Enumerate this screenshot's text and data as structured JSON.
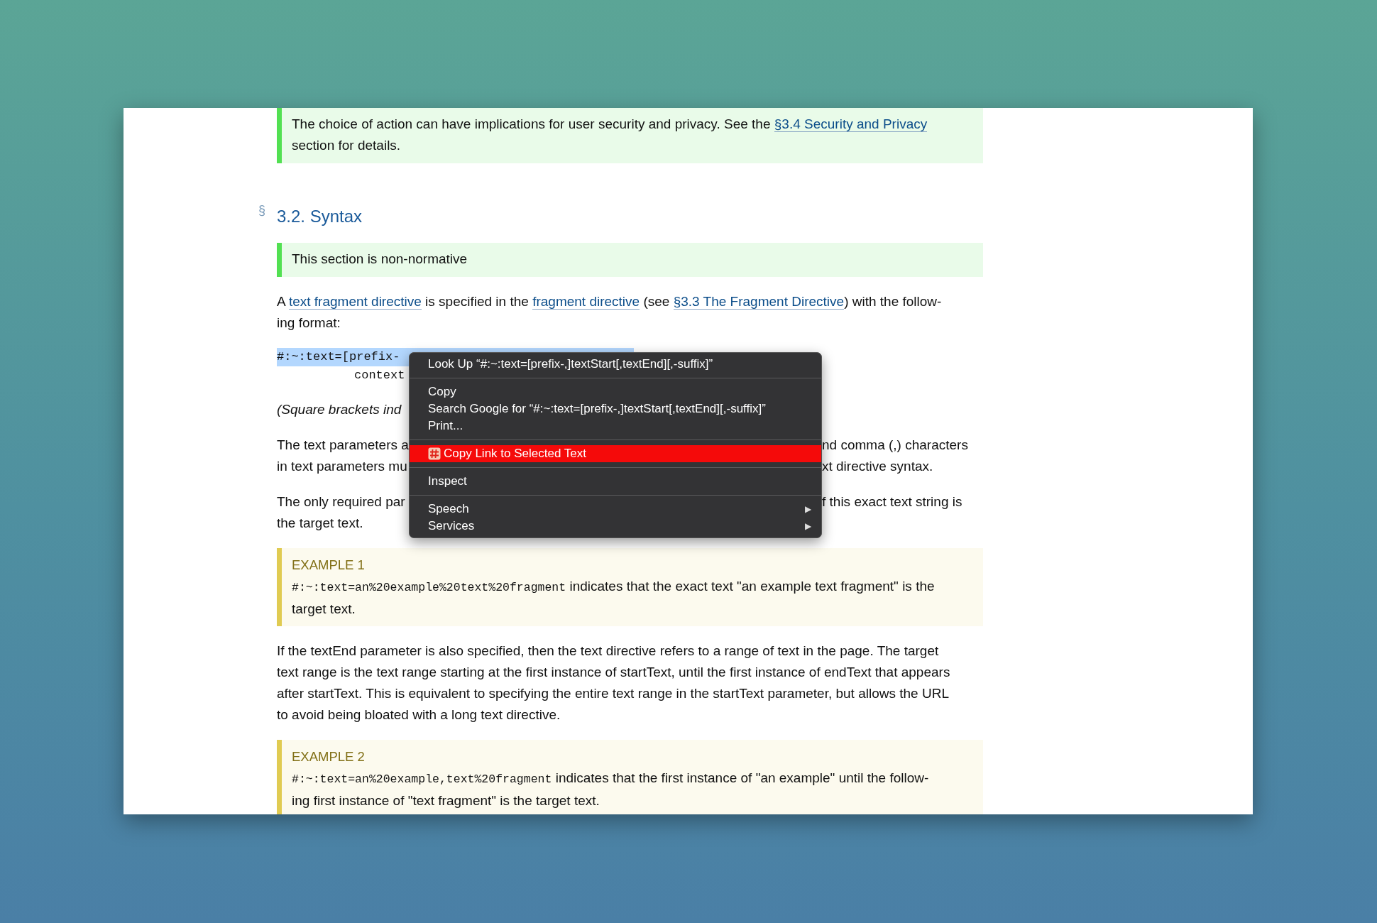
{
  "blocks": [
    {
      "kind": "note",
      "lines": [
        [
          {
            "text": "The choice of action can have implications for user security and privacy. See the "
          },
          {
            "text": "§3.4 Security and Privacy",
            "link": true
          }
        ],
        [
          {
            "text": "section for details."
          }
        ]
      ]
    },
    {
      "kind": "heading",
      "marker": "§",
      "title": "3.2. Syntax"
    },
    {
      "kind": "note",
      "lines": [
        [
          {
            "text": "This section is non-normative"
          }
        ]
      ]
    },
    {
      "kind": "paragraph",
      "lines": [
        [
          {
            "text": "A "
          },
          {
            "text": "text fragment directive",
            "link": true
          },
          {
            "text": " is specified in the "
          },
          {
            "text": "fragment directive",
            "link": true
          },
          {
            "text": " (see "
          },
          {
            "text": "§3.3 The Fragment Directive",
            "link": true
          },
          {
            "text": ") with the follow-"
          }
        ],
        [
          {
            "text": "ing format:"
          }
        ]
      ]
    },
    {
      "kind": "code",
      "lines": [
        {
          "text": "#:~:text=[prefix-",
          "selected": true,
          "indent": false
        },
        {
          "text": "context",
          "selected": false,
          "indent": true
        }
      ]
    },
    {
      "kind": "covered",
      "italic": true,
      "lines": [
        {
          "left": "(Square brackets ind"
        }
      ]
    },
    {
      "kind": "covered",
      "italic": false,
      "lines": [
        {
          "left": "The text parameters a",
          "right": "nd comma (,) characters"
        },
        {
          "left": "in text parameters mu",
          "right": "xt directive syntax."
        }
      ]
    },
    {
      "kind": "covered",
      "italic": false,
      "lines": [
        {
          "left": "The only required par",
          "right": "f this exact text string is"
        },
        {
          "left": "the target text."
        }
      ]
    },
    {
      "kind": "example",
      "label": "EXAMPLE 1",
      "lines": [
        [
          {
            "text": "#:~:text=an%20example%20text%20fragment",
            "code": true
          },
          {
            "text": " indicates that the exact text \"an example text fragment\" is the"
          }
        ],
        [
          {
            "text": "target text."
          }
        ]
      ]
    },
    {
      "kind": "paragraph",
      "lines": [
        [
          {
            "text": "If the textEnd parameter is also specified, then the text directive refers to a range of text in the page. The target"
          }
        ],
        [
          {
            "text": "text range is the text range starting at the first instance of startText, until the first instance of endText that appears"
          }
        ],
        [
          {
            "text": "after startText. This is equivalent to specifying the entire text range in the startText parameter, but allows the URL"
          }
        ],
        [
          {
            "text": "to avoid being bloated with a long text directive."
          }
        ]
      ]
    },
    {
      "kind": "example",
      "label": "EXAMPLE 2",
      "lines": [
        [
          {
            "text": "#:~:text=an%20example,text%20fragment",
            "code": true
          },
          {
            "text": " indicates that the first instance of \"an example\" until the follow-"
          }
        ],
        [
          {
            "text": "ing first instance of \"text fragment\" is the target text."
          }
        ]
      ]
    }
  ],
  "context_menu": {
    "groups": [
      {
        "items": [
          {
            "label": "Look Up “#:~:text=[prefix-,]textStart[,textEnd][,-suffix]”",
            "selected": false
          }
        ]
      },
      {
        "items": [
          {
            "label": "Copy",
            "selected": false
          },
          {
            "label": "Search Google for “#:~:text=[prefix-,]textStart[,textEnd][,-suffix]”",
            "selected": false
          },
          {
            "label": "Print...",
            "selected": false
          }
        ]
      },
      {
        "items": [
          {
            "label": "Copy Link to Selected Text",
            "selected": true,
            "has_icon": true
          }
        ]
      },
      {
        "items": [
          {
            "label": "Inspect",
            "selected": false
          }
        ]
      },
      {
        "items": [
          {
            "label": "Speech",
            "selected": false,
            "submenu_arrow": "▶"
          },
          {
            "label": "Services",
            "selected": false,
            "submenu_arrow": "▶"
          }
        ]
      }
    ]
  }
}
